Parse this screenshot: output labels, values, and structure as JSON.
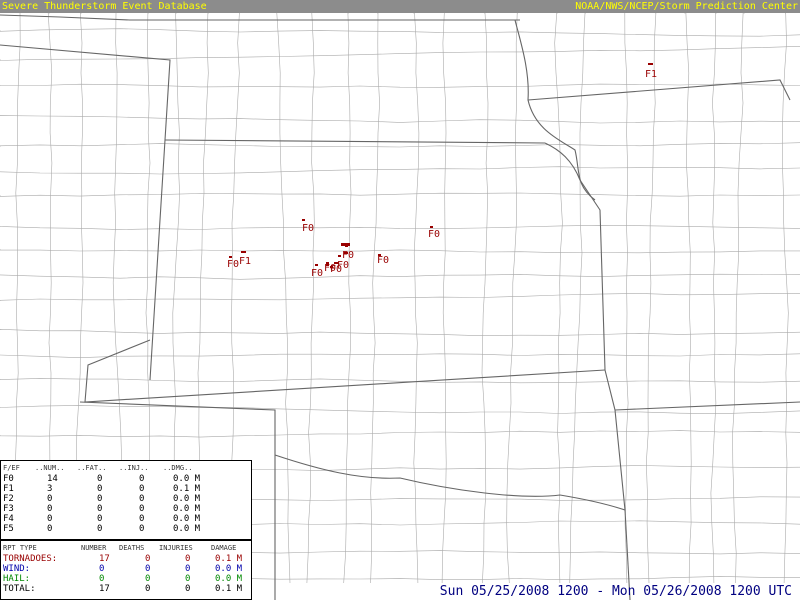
{
  "header": {
    "left": "Severe Thunderstorm Event Database",
    "right": "NOAA/NWS/NCEP/Storm Prediction Center"
  },
  "colors": {
    "header_bg": "#8c8c8c",
    "header_text": "#ffff00",
    "tornado": "#990000",
    "wind": "#0000aa",
    "hail": "#008800",
    "date_text": "#000080",
    "boundary": "#aaaaaa",
    "state_line": "#666666"
  },
  "tornado_labels": [
    {
      "label": "F1",
      "id": "iowa"
    },
    {
      "label": "F0",
      "id": "cent-north"
    },
    {
      "label": "F0",
      "id": "ne-kansas"
    },
    {
      "label": "F0",
      "id": "west-1"
    },
    {
      "label": "F1",
      "id": "west-2"
    },
    {
      "label": "F0",
      "id": "cluster-1"
    },
    {
      "label": "F0",
      "id": "cluster-2"
    },
    {
      "label": "F0",
      "id": "cluster-3"
    },
    {
      "label": "F0",
      "id": "cluster-4"
    },
    {
      "label": "F0",
      "id": "cluster-5"
    },
    {
      "label": "F0",
      "id": "east-1"
    }
  ],
  "stats_table": {
    "headers": [
      "F/EF",
      "..NUM..",
      "..FAT..",
      "..INJ..",
      "..DMG.."
    ],
    "rows": [
      {
        "scale": "F0",
        "num": "14",
        "fat": "0",
        "inj": "0",
        "dmg": "0.0 M"
      },
      {
        "scale": "F1",
        "num": "3",
        "fat": "0",
        "inj": "0",
        "dmg": "0.1 M"
      },
      {
        "scale": "F2",
        "num": "0",
        "fat": "0",
        "inj": "0",
        "dmg": "0.0 M"
      },
      {
        "scale": "F3",
        "num": "0",
        "fat": "0",
        "inj": "0",
        "dmg": "0.0 M"
      },
      {
        "scale": "F4",
        "num": "0",
        "fat": "0",
        "inj": "0",
        "dmg": "0.0 M"
      },
      {
        "scale": "F5",
        "num": "0",
        "fat": "0",
        "inj": "0",
        "dmg": "0.0 M"
      }
    ]
  },
  "summary_table": {
    "headers": [
      "RPT TYPE",
      "NUMBER",
      "DEATHS",
      "INJURIES",
      "DAMAGE"
    ],
    "rows": [
      {
        "type": "TORNADOES:",
        "number": "17",
        "deaths": "0",
        "injuries": "0",
        "damage": "0.1 M"
      },
      {
        "type": "WIND:",
        "number": "0",
        "deaths": "0",
        "injuries": "0",
        "damage": "0.0 M"
      },
      {
        "type": "HAIL:",
        "number": "0",
        "deaths": "0",
        "injuries": "0",
        "damage": "0.0 M"
      },
      {
        "type": "TOTAL:",
        "number": "17",
        "deaths": "0",
        "injuries": "0",
        "damage": "0.1 M"
      }
    ]
  },
  "date_range": "Sun 05/25/2008 1200 - Mon 05/26/2008 1200 UTC"
}
